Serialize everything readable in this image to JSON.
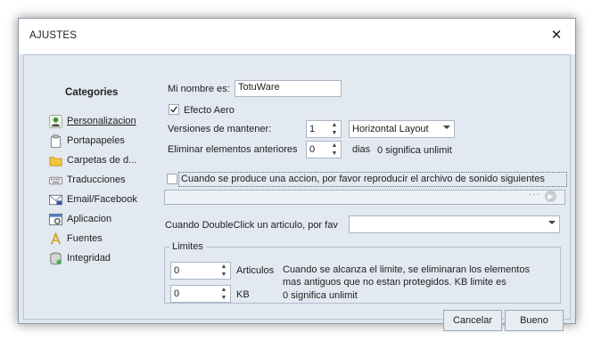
{
  "window": {
    "title": "AJUSTES",
    "close_glyph": "✕"
  },
  "sidebar": {
    "title": "Categories",
    "items": [
      {
        "label": "Personalizacion",
        "icon": "user-icon",
        "active": true
      },
      {
        "label": "Portapapeles",
        "icon": "clipboard-icon"
      },
      {
        "label": "Carpetas de d...",
        "icon": "folder-icon"
      },
      {
        "label": "Traducciones",
        "icon": "keyboard-icon"
      },
      {
        "label": "Email/Facebook",
        "icon": "email-icon"
      },
      {
        "label": "Aplicacion",
        "icon": "application-icon"
      },
      {
        "label": "Fuentes",
        "icon": "font-icon"
      },
      {
        "label": "Integridad",
        "icon": "database-icon"
      }
    ]
  },
  "form": {
    "name_label": "Mi nombre es:",
    "name_value": "TotuWare",
    "aero_label": "Efecto Aero",
    "aero_checked": true,
    "versions_label": "Versiones de mantener:",
    "versions_value": "1",
    "layout_value": "Horizontal Layout",
    "delete_label": "Eliminar elementos anteriores",
    "delete_value": "0",
    "delete_unit": "dias",
    "delete_note": "0 significa unlimit",
    "sound_label": "Cuando se produce una accion, por favor reproducir el archivo de sonido siguientes",
    "sound_checked": false,
    "sound_file_value": "",
    "browse_glyph": "···",
    "play_glyph": "▶",
    "doubleclick_label": "Cuando DoubleClick un articulo, por fav",
    "doubleclick_value": ""
  },
  "limits": {
    "title": "Limites",
    "articles_value": "0",
    "articles_label": "Articulos",
    "kb_value": "0",
    "kb_label": "KB",
    "note_line1": "Cuando se alcanza el limite, se eliminaran los elementos",
    "note_line2": "mas antiguos que no estan protegidos. KB limite es",
    "note_line3": "0 significa unlimit"
  },
  "footer": {
    "cancel_label": "Cancelar",
    "ok_label": "Bueno"
  },
  "colors": {
    "dialog_bg": "#e3e9f1",
    "accent": "#6f9bd1"
  }
}
